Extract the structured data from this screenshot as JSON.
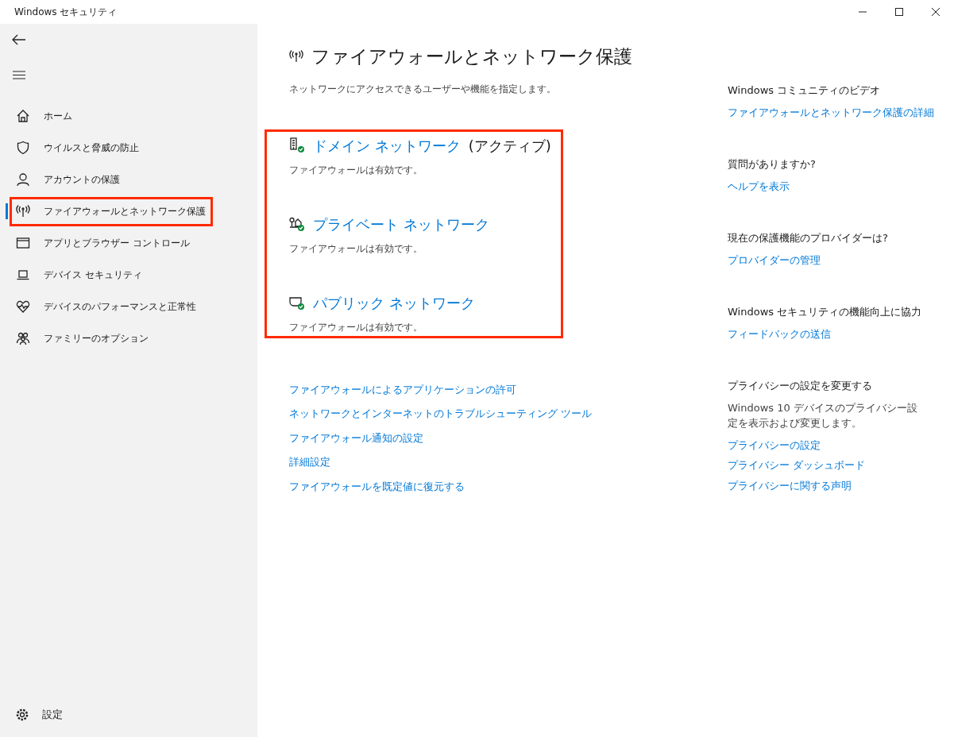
{
  "window": {
    "title": "Windows セキュリティ"
  },
  "sidebar": {
    "items": [
      {
        "label": "ホーム",
        "kind": "home",
        "selected": false,
        "highlighted": false
      },
      {
        "label": "ウイルスと脅威の防止",
        "kind": "shield",
        "selected": false,
        "highlighted": false
      },
      {
        "label": "アカウントの保護",
        "kind": "person",
        "selected": false,
        "highlighted": false
      },
      {
        "label": "ファイアウォールとネットワーク保護",
        "kind": "antenna",
        "selected": true,
        "highlighted": true
      },
      {
        "label": "アプリとブラウザー コントロール",
        "kind": "window",
        "selected": false,
        "highlighted": false
      },
      {
        "label": "デバイス セキュリティ",
        "kind": "laptop",
        "selected": false,
        "highlighted": false
      },
      {
        "label": "デバイスのパフォーマンスと正常性",
        "kind": "heart",
        "selected": false,
        "highlighted": false
      },
      {
        "label": "ファミリーのオプション",
        "kind": "family",
        "selected": false,
        "highlighted": false
      }
    ],
    "settings": "設定"
  },
  "page": {
    "title": "ファイアウォールとネットワーク保護",
    "subtitle": "ネットワークにアクセスできるユーザーや機能を指定します。"
  },
  "networks": {
    "highlighted": true,
    "items": [
      {
        "name": "ドメイン ネットワーク",
        "suffix": "(アクティブ)",
        "kind": "domain",
        "status": "ファイアウォールは有効です。",
        "protected": true
      },
      {
        "name": "プライベート ネットワーク",
        "kind": "private",
        "status": "ファイアウォールは有効です。",
        "protected": true
      },
      {
        "name": "パブリック ネットワーク",
        "kind": "public",
        "status": "ファイアウォールは有効です。",
        "protected": true
      }
    ]
  },
  "links": [
    "ファイアウォールによるアプリケーションの許可",
    "ネットワークとインターネットのトラブルシューティング ツール",
    "ファイアウォール通知の設定",
    "詳細設定",
    "ファイアウォールを既定値に復元する"
  ],
  "aside": [
    {
      "heading": "Windows コミュニティのビデオ",
      "links": [
        "ファイアウォールとネットワーク保護の詳細"
      ]
    },
    {
      "heading": "質問がありますか?",
      "links": [
        "ヘルプを表示"
      ]
    },
    {
      "heading": "現在の保護機能のプロバイダーは?",
      "links": [
        "プロバイダーの管理"
      ]
    },
    {
      "heading": "Windows セキュリティの機能向上に協力",
      "links": [
        "フィードバックの送信"
      ]
    },
    {
      "heading": "プライバシーの設定を変更する",
      "text": "Windows 10 デバイスのプライバシー設定を表示および変更します。",
      "links": [
        "プライバシーの設定",
        "プライバシー ダッシュボード",
        "プライバシーに関する声明"
      ]
    }
  ]
}
